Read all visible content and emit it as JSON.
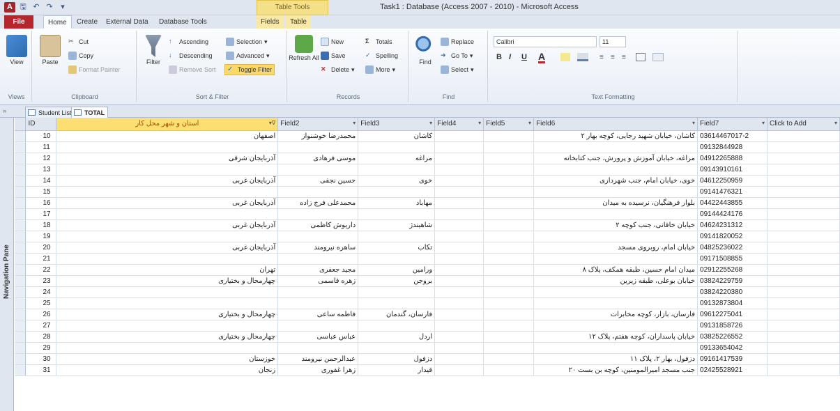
{
  "app": {
    "title": "Task1 : Database (Access 2007 - 2010) - Microsoft Access",
    "context_tab": "Table Tools"
  },
  "ribbon_tabs": [
    "File",
    "Home",
    "Create",
    "External Data",
    "Database Tools",
    "Fields",
    "Table"
  ],
  "ribbon": {
    "views": {
      "view": "View",
      "group": "Views"
    },
    "clipboard": {
      "paste": "Paste",
      "cut": "Cut",
      "copy": "Copy",
      "format_painter": "Format Painter",
      "group": "Clipboard"
    },
    "sort_filter": {
      "filter": "Filter",
      "ascending": "Ascending",
      "descending": "Descending",
      "remove_sort": "Remove Sort",
      "selection": "Selection",
      "advanced": "Advanced",
      "toggle_filter": "Toggle Filter",
      "group": "Sort & Filter"
    },
    "records": {
      "refresh": "Refresh All",
      "new": "New",
      "save": "Save",
      "delete": "Delete",
      "totals": "Totals",
      "spelling": "Spelling",
      "more": "More",
      "group": "Records"
    },
    "find": {
      "find": "Find",
      "replace": "Replace",
      "goto": "Go To",
      "select": "Select",
      "group": "Find"
    },
    "text_formatting": {
      "font": "Calibri",
      "size": "11",
      "bold": "B",
      "italic": "I",
      "underline": "U",
      "font_color": "A",
      "group": "Text Formatting"
    }
  },
  "object_tabs": [
    {
      "label": "Student List",
      "active": false
    },
    {
      "label": "TOTAL",
      "active": true
    }
  ],
  "nav_pane": {
    "label": "Navigation Pane"
  },
  "columns": [
    {
      "label": "ID",
      "sorted": false
    },
    {
      "label": "استان و شهر محل کار",
      "sorted": true
    },
    {
      "label": "Field2",
      "sorted": false
    },
    {
      "label": "Field3",
      "sorted": false
    },
    {
      "label": "Field4",
      "sorted": false
    },
    {
      "label": "Field5",
      "sorted": false
    },
    {
      "label": "Field6",
      "sorted": false
    },
    {
      "label": "Field7",
      "sorted": false
    },
    {
      "label": "Click to Add",
      "sorted": false
    }
  ],
  "rows": [
    {
      "id": "10",
      "c1": "اصفهان",
      "c2": "محمدرضا خوشنواز",
      "c3": "کاشان",
      "c6": "کاشان، خیابان شهید رجایی، کوچه بهار ۲",
      "c7": "03614467017-2"
    },
    {
      "id": "11",
      "c1": "",
      "c2": "",
      "c3": "",
      "c6": "",
      "c7": "09132844928"
    },
    {
      "id": "12",
      "c1": "آذربایجان شرقی",
      "c2": "موسی فرهادی",
      "c3": "مراغه",
      "c6": "مراغه، خیابان آموزش و پرورش، جنب کتابخانه",
      "c7": "04912265888"
    },
    {
      "id": "13",
      "c1": "",
      "c2": "",
      "c3": "",
      "c6": "",
      "c7": "09143910161"
    },
    {
      "id": "14",
      "c1": "آذربایجان غربی",
      "c2": "حسین نجفی",
      "c3": "خوی",
      "c6": "خوی، خیابان امام، جنب شهرداری",
      "c7": "04612250959"
    },
    {
      "id": "15",
      "c1": "",
      "c2": "",
      "c3": "",
      "c6": "",
      "c7": "09141476321"
    },
    {
      "id": "16",
      "c1": "آذربایجان غربی",
      "c2": "محمدعلی فرج زاده",
      "c3": "مهاباد",
      "c6": "بلوار فرهنگیان، نرسیده به میدان",
      "c7": "04422443855"
    },
    {
      "id": "17",
      "c1": "",
      "c2": "",
      "c3": "",
      "c6": "",
      "c7": "09144424176"
    },
    {
      "id": "18",
      "c1": "آذربایجان غربی",
      "c2": "داریوش کاظمی",
      "c3": "شاهیندژ",
      "c6": "خیابان خاقانی، جنب کوچه ۲",
      "c7": "04624231312"
    },
    {
      "id": "19",
      "c1": "",
      "c2": "",
      "c3": "",
      "c6": "",
      "c7": "09141820052"
    },
    {
      "id": "20",
      "c1": "آذربایجان غربی",
      "c2": "ساهره نیرومند",
      "c3": "تکاب",
      "c6": "خیابان امام، روبروی مسجد",
      "c7": "04825236022"
    },
    {
      "id": "21",
      "c1": "",
      "c2": "",
      "c3": "",
      "c6": "",
      "c7": "09171508855"
    },
    {
      "id": "22",
      "c1": "تهران",
      "c2": "مجید جعفری",
      "c3": "ورامین",
      "c6": "میدان امام حسین، طبقه همکف، پلاک ۸",
      "c7": "02912255268"
    },
    {
      "id": "23",
      "c1": "چهارمحال و بختیاری",
      "c2": "زهره قاسمی",
      "c3": "بروجن",
      "c6": "خیابان بوعلی، طبقه زیرین",
      "c7": "03824229759"
    },
    {
      "id": "24",
      "c1": "",
      "c2": "",
      "c3": "",
      "c6": "",
      "c7": "03824220380"
    },
    {
      "id": "25",
      "c1": "",
      "c2": "",
      "c3": "",
      "c6": "",
      "c7": "09132873804"
    },
    {
      "id": "26",
      "c1": "چهارمحال و بختیاری",
      "c2": "فاطمه ساعی",
      "c3": "فارسان، گندمان",
      "c6": "فارسان، بازار، کوچه مخابرات",
      "c7": "09612275041"
    },
    {
      "id": "27",
      "c1": "",
      "c2": "",
      "c3": "",
      "c6": "",
      "c7": "09131858726"
    },
    {
      "id": "28",
      "c1": "چهارمحال و بختیاری",
      "c2": "عباس عباسی",
      "c3": "اردل",
      "c6": "خیابان پاسداران، کوچه هفتم، پلاک ۱۲",
      "c7": "03825226552"
    },
    {
      "id": "29",
      "c1": "",
      "c2": "",
      "c3": "",
      "c6": "",
      "c7": "09133654042"
    },
    {
      "id": "30",
      "c1": "خوزستان",
      "c2": "عبدالرحمن نیرومند",
      "c3": "دزفول",
      "c6": "دزفول، بهار ۲، پلاک ۱۱",
      "c7": "09161417539"
    },
    {
      "id": "31",
      "c1": "زنجان",
      "c2": "زهرا غفوری",
      "c3": "قیدار",
      "c6": "جنب مسجد امیرالمومنین، کوچه بن بست ۲۰",
      "c7": "02425528921"
    }
  ]
}
